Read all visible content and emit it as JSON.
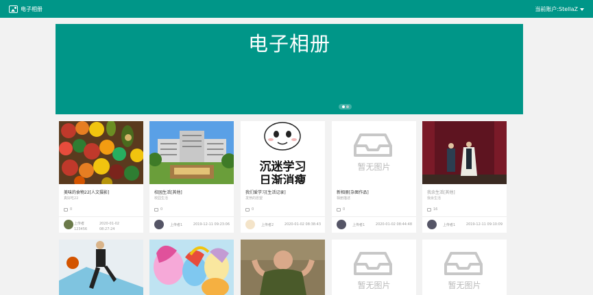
{
  "header": {
    "app_title": "电子相册",
    "account_label": "当前账户:StellaZ"
  },
  "banner": {
    "title": "电子相册"
  },
  "placeholder_text": "暂无图片",
  "albums": [
    {
      "title": "美味的食物22[人文摄影]",
      "desc": "真好吃22",
      "likes": "0",
      "uploader": "上传者123456",
      "date": "2020-01-02 08:27:24"
    },
    {
      "title": "校园生活[其他]",
      "desc": "校园生活",
      "likes": "0",
      "uploader": "上传者1",
      "date": "2019-12-11 09:23:06"
    },
    {
      "title": "我们爱学习[生活记录]",
      "desc": "发愤的愿望",
      "likes": "0",
      "uploader": "上传者2",
      "date": "2020-01-02 08:38:43"
    },
    {
      "title": "新相册[杂图作品]",
      "desc": "相册描述",
      "likes": "0",
      "uploader": "上传者1",
      "date": "2020-01-02 08:44:48"
    },
    {
      "title": "我余生活[其他]",
      "desc": "我余生活",
      "likes": "16",
      "uploader": "上传者1",
      "date": "2019-12-11 09:10:09"
    }
  ],
  "banner_image_overlay": {
    "study_line1": "沉迷学习",
    "study_line2": "日渐消瘦"
  }
}
